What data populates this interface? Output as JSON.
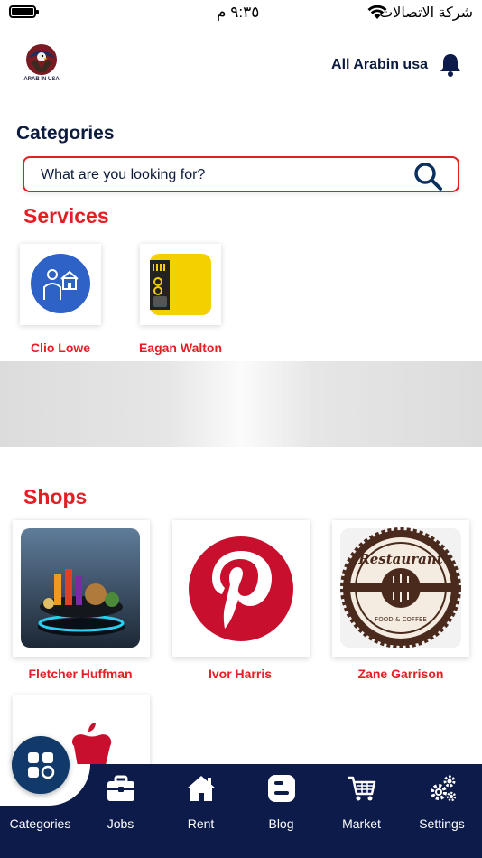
{
  "status_bar": {
    "time": "٩:٣٥ م",
    "carrier": "شركة الاتصالات"
  },
  "header": {
    "logo_text": "ARAB IN USA",
    "account_name": "All Arabin usa"
  },
  "page_title": "Categories",
  "search": {
    "placeholder": "What are you looking for?"
  },
  "services": {
    "title": "Services",
    "items": [
      {
        "label": "Clio Lowe",
        "icon": "real-estate-agent-icon"
      },
      {
        "label": "Eagan Walton",
        "icon": "barber-tools-icon"
      }
    ]
  },
  "shops": {
    "title": "Shops",
    "items": [
      {
        "label": "Fletcher Huffman",
        "icon": "food-platter-image"
      },
      {
        "label": "Ivor Harris",
        "icon": "pinterest-logo"
      },
      {
        "label": "Zane Garrison",
        "icon": "restaurant-badge-logo"
      },
      {
        "label": "",
        "icon": "apple-logo"
      }
    ],
    "restaurant_badge_top": "Restaurant",
    "restaurant_badge_bottom": "FOOD & COFFEE"
  },
  "bottom_nav": {
    "items": [
      {
        "label": "Categories",
        "icon": "grid-icon"
      },
      {
        "label": "Jobs",
        "icon": "briefcase-icon"
      },
      {
        "label": "Rent",
        "icon": "home-icon"
      },
      {
        "label": "Blog",
        "icon": "blogger-icon"
      },
      {
        "label": "Market",
        "icon": "cart-icon"
      },
      {
        "label": "Settings",
        "icon": "gears-icon"
      }
    ]
  },
  "colors": {
    "accent_red": "#e31e24",
    "navy": "#0d1b4a",
    "fab_blue": "#113a6a"
  }
}
